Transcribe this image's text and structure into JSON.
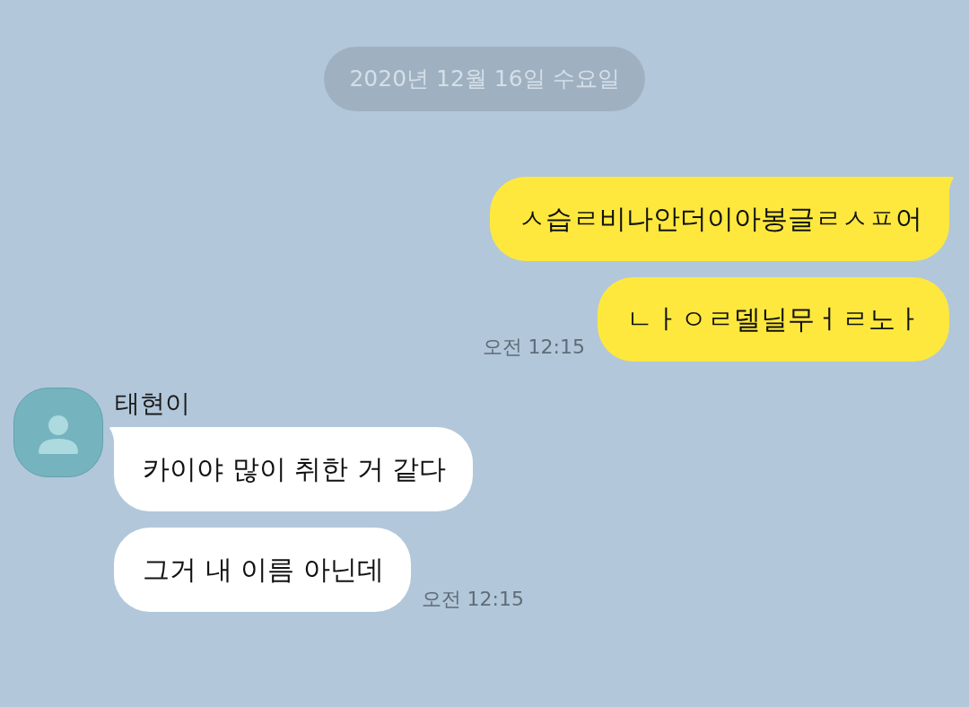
{
  "date_divider": "2020년 12월 16일 수요일",
  "groups": [
    {
      "kind": "sent",
      "messages": [
        {
          "text": "ㅅ습ㄹ비나안더이아봉글ㄹㅅㅍ어"
        },
        {
          "text": "ㄴㅏㅇㄹ델닐무ㅓㄹ노ㅏ"
        }
      ],
      "time": "오전 12:15"
    },
    {
      "kind": "received",
      "sender": "태현이",
      "messages": [
        {
          "text": "카이야 많이 취한 거 같다"
        },
        {
          "text": "그거 내 이름 아닌데"
        }
      ],
      "time": "오전 12:15"
    }
  ]
}
